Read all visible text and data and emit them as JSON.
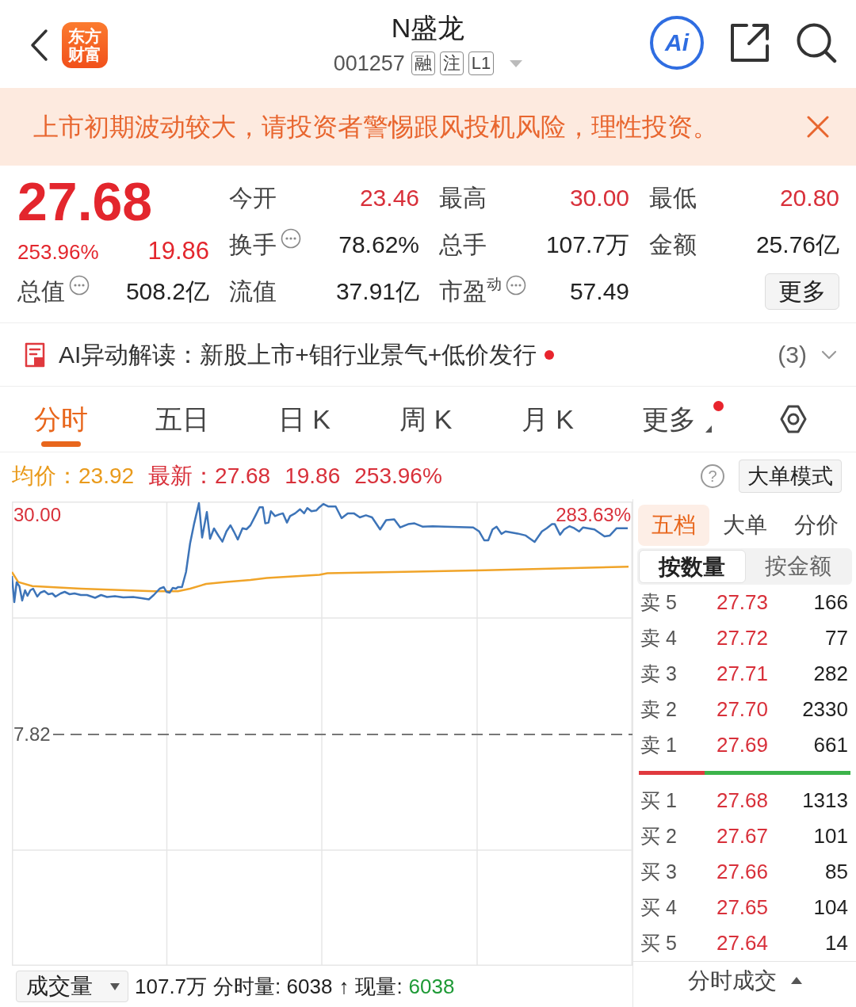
{
  "header": {
    "logo": "东方财富",
    "title": "N盛龙",
    "code": "001257",
    "badges": [
      "融",
      "注",
      "L1"
    ],
    "ai_button": "Ai"
  },
  "banner": {
    "text": "上市初期波动较大，请投资者警惕跟风投机风险，理性投资。"
  },
  "quote": {
    "price": "27.68",
    "change_pct": "253.96%",
    "change": "19.86"
  },
  "stats": [
    {
      "label": "今开",
      "value": "23.46",
      "color": "#d8303a",
      "info": false
    },
    {
      "label": "最高",
      "value": "30.00",
      "color": "#d8303a",
      "info": false
    },
    {
      "label": "最低",
      "value": "20.80",
      "color": "#d8303a",
      "info": false
    },
    {
      "label": "换手",
      "value": "78.62%",
      "color": "#222222",
      "info": true
    },
    {
      "label": "总手",
      "value": "107.7万",
      "color": "#222222",
      "info": false
    },
    {
      "label": "金额",
      "value": "25.76亿",
      "color": "#222222",
      "info": false
    },
    {
      "label": "总值",
      "value": "508.2亿",
      "color": "#222222",
      "info": true
    },
    {
      "label": "流值",
      "value": "37.91亿",
      "color": "#222222",
      "info": false
    },
    {
      "label": "市盈$^{动}$",
      "value": "57.49",
      "color": "#222222",
      "info": true
    }
  ],
  "more_button": "更多",
  "ai_insight": {
    "text": "AI异动解读：新股上市+钼行业景气+低价发行",
    "unread": true,
    "count": "(3)"
  },
  "tabs": [
    {
      "label": "分时",
      "selected": true,
      "unread": false,
      "kind": "tab"
    },
    {
      "label": "五日",
      "selected": false,
      "unread": false,
      "kind": "tab"
    },
    {
      "label": "日 K",
      "selected": false,
      "unread": false,
      "kind": "tab"
    },
    {
      "label": "周 K",
      "selected": false,
      "unread": false,
      "kind": "tab"
    },
    {
      "label": "月 K",
      "selected": false,
      "unread": false,
      "kind": "tab"
    },
    {
      "label": "更多",
      "selected": false,
      "unread": true,
      "kind": "menu"
    }
  ],
  "price_info": [
    {
      "text": "均价：23.92",
      "color": "#e99a1b"
    },
    {
      "text": "最新：27.68",
      "color": "#d8303a"
    },
    {
      "text": "19.86",
      "color": "#d8303a"
    },
    {
      "text": "253.96%",
      "color": "#d8303a"
    }
  ],
  "help": "?",
  "big_order_button": "大单模式",
  "chart": {
    "top_price": "30.00",
    "top_pct": "283.63%",
    "prev_close": "7.82"
  },
  "volume_bar": {
    "selector": "成交量",
    "items": [
      {
        "text": "107.7万",
        "color": "#222222"
      },
      {
        "text": "分时量: 6038",
        "color": "#222222"
      },
      {
        "text": "↑",
        "color": "#222222"
      },
      {
        "text": "现量:",
        "color": "#222222"
      },
      {
        "text": "6038",
        "color": "#1e9a36"
      }
    ]
  },
  "order_book": {
    "tabs": [
      {
        "label": "五档",
        "selected": true
      },
      {
        "label": "大单",
        "selected": false
      },
      {
        "label": "分价",
        "selected": false
      }
    ],
    "modes": [
      {
        "label": "按数量",
        "selected": true
      },
      {
        "label": "按金额",
        "selected": false
      }
    ],
    "asks": [
      {
        "label": "卖 5",
        "price": "27.73",
        "volume": "166"
      },
      {
        "label": "卖 4",
        "price": "27.72",
        "volume": "77"
      },
      {
        "label": "卖 3",
        "price": "27.71",
        "volume": "282"
      },
      {
        "label": "卖 2",
        "price": "27.70",
        "volume": "2330"
      },
      {
        "label": "卖 1",
        "price": "27.69",
        "volume": "661"
      }
    ],
    "ratio": {
      "level": 0.31
    },
    "bids": [
      {
        "label": "买 1",
        "price": "27.68",
        "volume": "1313"
      },
      {
        "label": "买 2",
        "price": "27.67",
        "volume": "101"
      },
      {
        "label": "买 3",
        "price": "27.66",
        "volume": "85"
      },
      {
        "label": "买 4",
        "price": "27.65",
        "volume": "104"
      },
      {
        "label": "买 5",
        "price": "27.64",
        "volume": "14"
      }
    ],
    "footer": "分时成交"
  }
}
